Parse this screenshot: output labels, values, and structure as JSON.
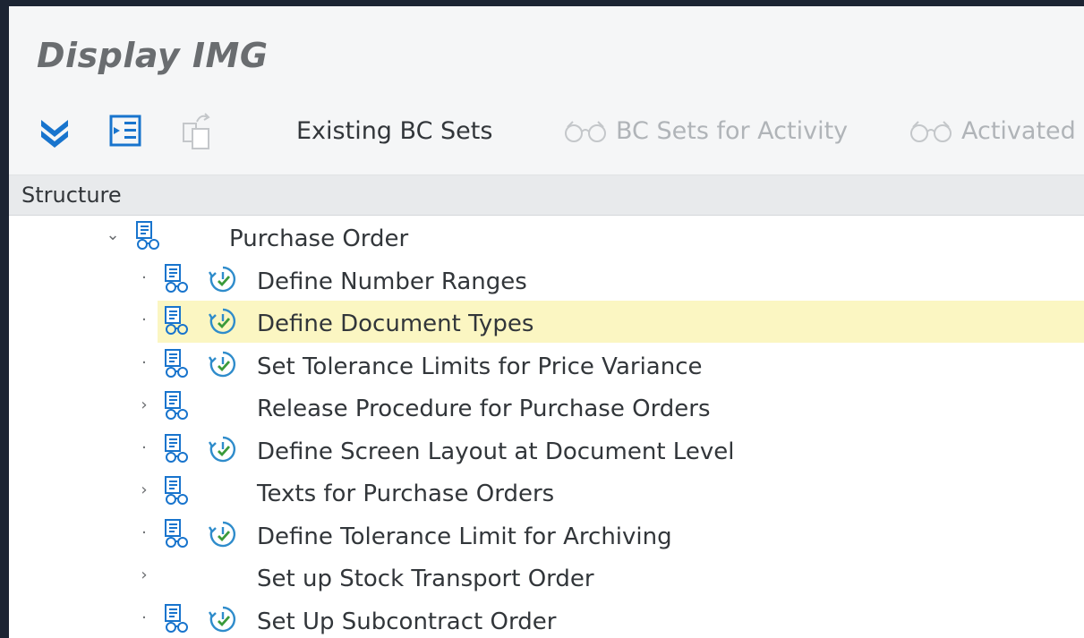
{
  "window": {
    "title": "Display IMG"
  },
  "toolbar": {
    "expand_all_icon": "double-chevron-down-icon",
    "find_icon": "find-in-structure-icon",
    "copy_icon": "copy-document-icon",
    "existing_bc_sets_label": "Existing BC Sets",
    "bc_sets_for_activity_label": "BC Sets for Activity",
    "activated_label": "Activated"
  },
  "structure": {
    "header": "Structure",
    "root": {
      "label": "Purchase Order",
      "expanded": true
    },
    "items": [
      {
        "label": "Define Number Ranges",
        "expander": "·",
        "has_doc_icon": true,
        "has_clock_icon": true,
        "selected": false
      },
      {
        "label": "Define Document Types",
        "expander": "·",
        "has_doc_icon": true,
        "has_clock_icon": true,
        "selected": true
      },
      {
        "label": "Set Tolerance Limits for Price Variance",
        "expander": "·",
        "has_doc_icon": true,
        "has_clock_icon": true,
        "selected": false
      },
      {
        "label": "Release Procedure for Purchase Orders",
        "expander": "›",
        "has_doc_icon": true,
        "has_clock_icon": false,
        "selected": false
      },
      {
        "label": "Define Screen Layout at Document Level",
        "expander": "·",
        "has_doc_icon": true,
        "has_clock_icon": true,
        "selected": false
      },
      {
        "label": "Texts for Purchase Orders",
        "expander": "›",
        "has_doc_icon": true,
        "has_clock_icon": false,
        "selected": false
      },
      {
        "label": "Define Tolerance Limit for Archiving",
        "expander": "·",
        "has_doc_icon": true,
        "has_clock_icon": true,
        "selected": false
      },
      {
        "label": "Set up Stock Transport Order",
        "expander": "›",
        "has_doc_icon": false,
        "has_clock_icon": false,
        "selected": false
      },
      {
        "label": "Set Up Subcontract Order",
        "expander": "·",
        "has_doc_icon": true,
        "has_clock_icon": true,
        "selected": false
      }
    ]
  },
  "colors": {
    "accent_blue": "#1874cd",
    "clock_blue": "#2f8ccb",
    "clock_check_green": "#3a9a3a",
    "selection_yellow": "#fcf9cf",
    "disabled_text": "#b0b4b8",
    "title_gray": "#6a6d70"
  }
}
